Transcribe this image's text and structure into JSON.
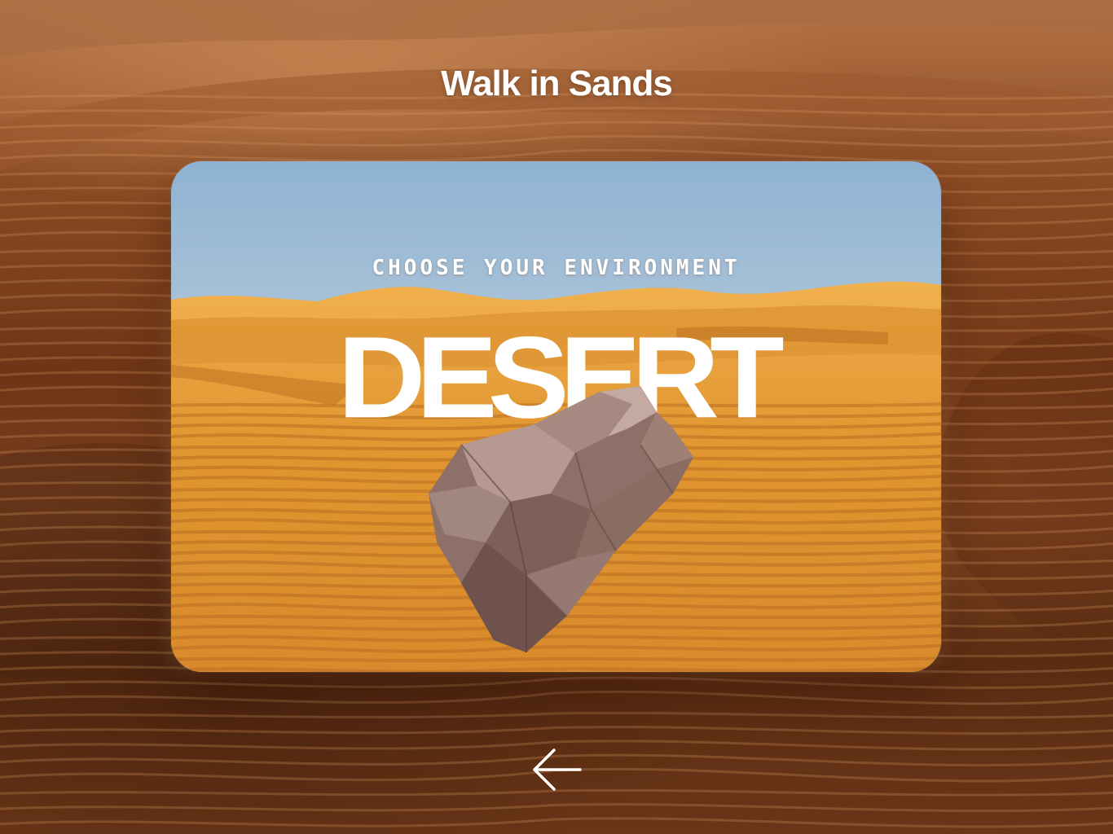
{
  "app": {
    "title": "Walk in Sands"
  },
  "environment_card": {
    "prompt": "CHOOSE YOUR ENVIRONMENT",
    "environment": "DESERT",
    "object": "rock-model"
  },
  "navigation": {
    "back_icon": "arrow-left-icon"
  },
  "colors": {
    "sky_top": "#8fb4d4",
    "sand": "#e39a3a",
    "background_sand": "#7a4020",
    "text": "#ffffff"
  }
}
